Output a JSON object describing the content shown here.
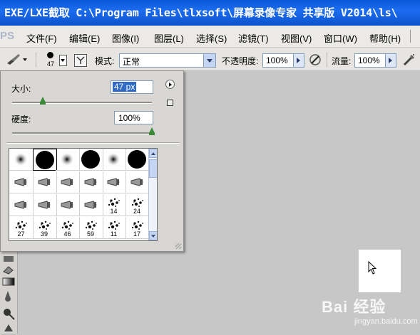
{
  "window": {
    "title": "EXE/LXE截取 C:\\Program Files\\tlxsoft\\屏幕录像专家 共享版 V2014\\ls\\"
  },
  "menubar": {
    "logo": "PS",
    "items": [
      "文件(F)",
      "编辑(E)",
      "图像(I)",
      "图层(L)",
      "选择(S)",
      "滤镜(T)",
      "视图(V)",
      "窗口(W)",
      "帮助(H)"
    ]
  },
  "options": {
    "brush_size": "47",
    "mode_label": "模式:",
    "mode_value": "正常",
    "opacity_label": "不透明度:",
    "opacity_value": "100%",
    "flow_label": "流量:",
    "flow_value": "100%"
  },
  "brush_panel": {
    "size_label": "大小:",
    "size_value": "47 px",
    "size_slider_fraction": 0.22,
    "hardness_label": "硬度:",
    "hardness_value": "100%",
    "hardness_slider_fraction": 1.0,
    "presets": [
      {
        "kind": "soft",
        "label": ""
      },
      {
        "kind": "hard",
        "label": ""
      },
      {
        "kind": "soft",
        "label": ""
      },
      {
        "kind": "hard",
        "label": ""
      },
      {
        "kind": "soft",
        "label": ""
      },
      {
        "kind": "hard",
        "label": ""
      },
      {
        "kind": "tool",
        "label": ""
      },
      {
        "kind": "tool",
        "label": ""
      },
      {
        "kind": "tool",
        "label": ""
      },
      {
        "kind": "tool",
        "label": ""
      },
      {
        "kind": "tool",
        "label": ""
      },
      {
        "kind": "tool",
        "label": ""
      },
      {
        "kind": "tool",
        "label": ""
      },
      {
        "kind": "tool",
        "label": ""
      },
      {
        "kind": "tool",
        "label": ""
      },
      {
        "kind": "tool",
        "label": ""
      },
      {
        "kind": "splat",
        "label": "14"
      },
      {
        "kind": "splat",
        "label": "24"
      },
      {
        "kind": "splat",
        "label": "27"
      },
      {
        "kind": "splat",
        "label": "39"
      },
      {
        "kind": "splat",
        "label": "46"
      },
      {
        "kind": "splat",
        "label": "59"
      },
      {
        "kind": "splat",
        "label": "11"
      },
      {
        "kind": "splat",
        "label": "17"
      }
    ],
    "selected_index": 1
  },
  "watermark": {
    "text": "Bai 经验",
    "sub": "jingyan.baidu.com"
  },
  "colors": {
    "titlebar": "#0a58d6",
    "selection": "#316ac5",
    "slider_thumb": "#3a8a3a"
  }
}
